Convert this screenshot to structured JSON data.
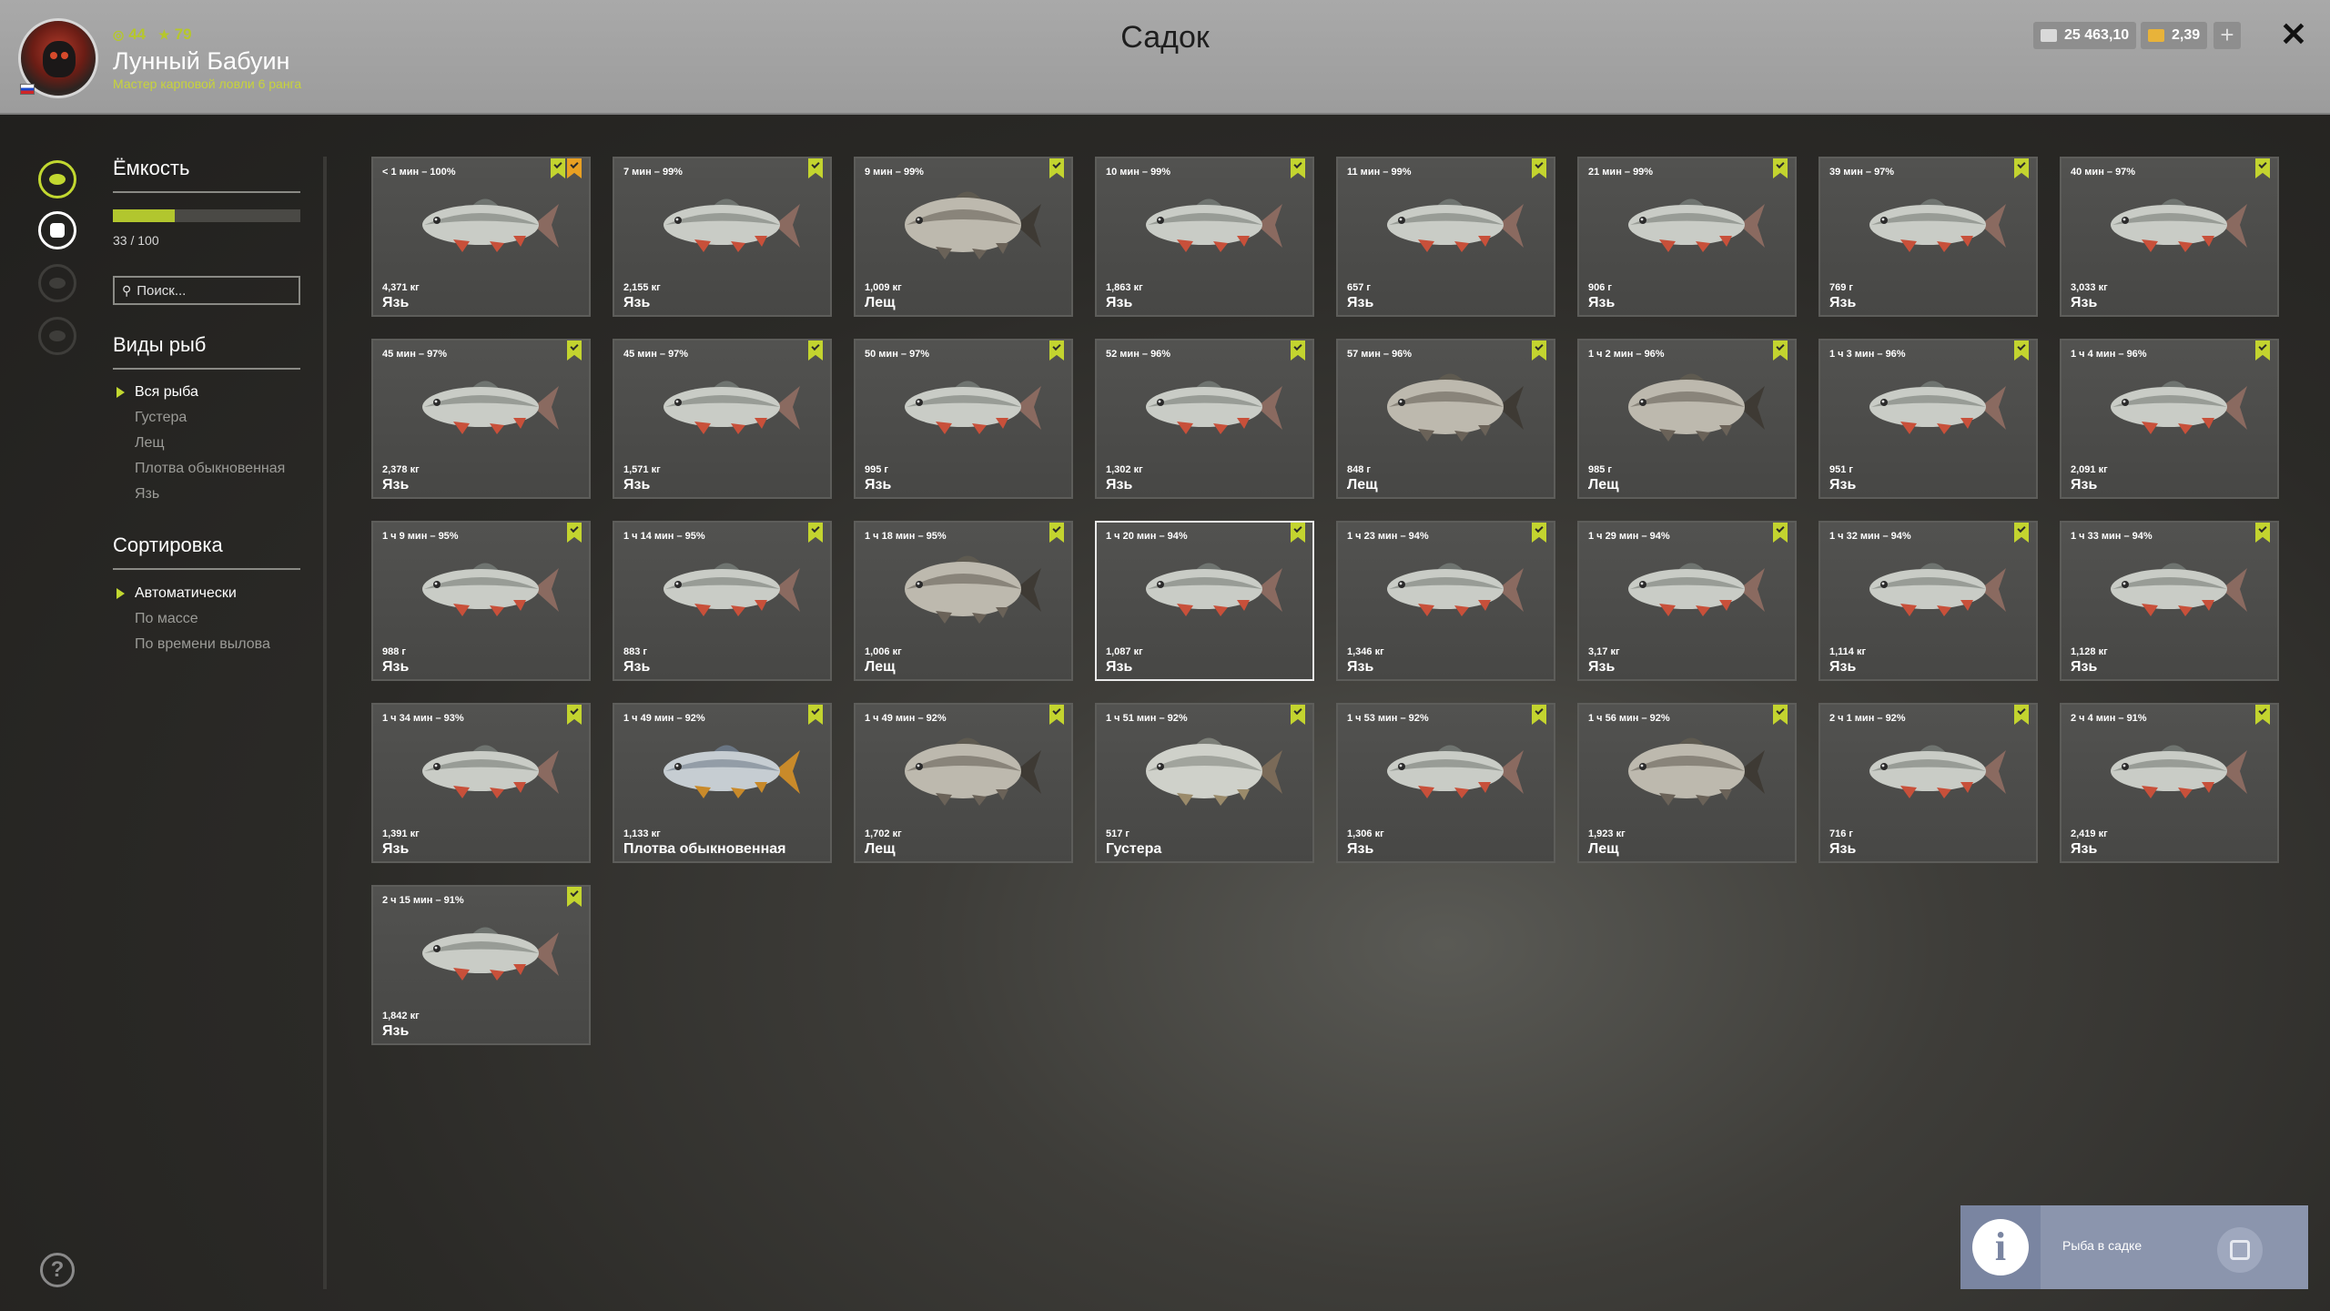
{
  "header": {
    "title": "Садок",
    "player": {
      "name": "Лунный Бабуин",
      "rank_title": "Мастер карповой ловли 6 ранга",
      "level": "44",
      "stars": "79"
    },
    "silver": "25 463,10",
    "gold": "2,39",
    "plus_icon": "+",
    "close_icon": "✕"
  },
  "sidebar": {
    "icons": [
      "fish-icon",
      "keepnet-icon",
      "boat-icon",
      "home-icon"
    ],
    "help_icon": "?"
  },
  "filters": {
    "capacity_title": "Ёмкость",
    "capacity_count": "33 / 100",
    "capacity_fraction": 0.33,
    "search_placeholder": "Поиск...",
    "species_title": "Виды рыб",
    "species": [
      "Вся рыба",
      "Густера",
      "Лещ",
      "Плотва обыкновенная",
      "Язь"
    ],
    "species_selected": 0,
    "sort_title": "Сортировка",
    "sort": [
      "Автоматически",
      "По массе",
      "По времени вылова"
    ],
    "sort_selected": 0
  },
  "fish": [
    {
      "time": "< 1 мин – 100%",
      "weight": "4,371 кг",
      "name": "Язь",
      "trophy": true
    },
    {
      "time": "7 мин – 99%",
      "weight": "2,155 кг",
      "name": "Язь"
    },
    {
      "time": "9 мин – 99%",
      "weight": "1,009 кг",
      "name": "Лещ"
    },
    {
      "time": "10 мин – 99%",
      "weight": "1,863 кг",
      "name": "Язь"
    },
    {
      "time": "11 мин – 99%",
      "weight": "657 г",
      "name": "Язь"
    },
    {
      "time": "21 мин – 99%",
      "weight": "906 г",
      "name": "Язь"
    },
    {
      "time": "39 мин – 97%",
      "weight": "769 г",
      "name": "Язь"
    },
    {
      "time": "40 мин – 97%",
      "weight": "3,033 кг",
      "name": "Язь"
    },
    {
      "time": "45 мин – 97%",
      "weight": "2,378 кг",
      "name": "Язь"
    },
    {
      "time": "45 мин – 97%",
      "weight": "1,571 кг",
      "name": "Язь"
    },
    {
      "time": "50 мин – 97%",
      "weight": "995 г",
      "name": "Язь"
    },
    {
      "time": "52 мин – 96%",
      "weight": "1,302 кг",
      "name": "Язь"
    },
    {
      "time": "57 мин – 96%",
      "weight": "848 г",
      "name": "Лещ"
    },
    {
      "time": "1 ч 2 мин – 96%",
      "weight": "985 г",
      "name": "Лещ"
    },
    {
      "time": "1 ч 3 мин – 96%",
      "weight": "951 г",
      "name": "Язь"
    },
    {
      "time": "1 ч 4 мин – 96%",
      "weight": "2,091 кг",
      "name": "Язь"
    },
    {
      "time": "1 ч 9 мин – 95%",
      "weight": "988 г",
      "name": "Язь"
    },
    {
      "time": "1 ч 14 мин – 95%",
      "weight": "883 г",
      "name": "Язь"
    },
    {
      "time": "1 ч 18 мин – 95%",
      "weight": "1,006 кг",
      "name": "Лещ"
    },
    {
      "time": "1 ч 20 мин – 94%",
      "weight": "1,087 кг",
      "name": "Язь",
      "selected": true
    },
    {
      "time": "1 ч 23 мин – 94%",
      "weight": "1,346 кг",
      "name": "Язь"
    },
    {
      "time": "1 ч 29 мин – 94%",
      "weight": "3,17 кг",
      "name": "Язь"
    },
    {
      "time": "1 ч 32 мин – 94%",
      "weight": "1,114 кг",
      "name": "Язь"
    },
    {
      "time": "1 ч 33 мин – 94%",
      "weight": "1,128 кг",
      "name": "Язь"
    },
    {
      "time": "1 ч 34 мин – 93%",
      "weight": "1,391 кг",
      "name": "Язь"
    },
    {
      "time": "1 ч 49 мин – 92%",
      "weight": "1,133 кг",
      "name": "Плотва обыкновенная"
    },
    {
      "time": "1 ч 49 мин – 92%",
      "weight": "1,702 кг",
      "name": "Лещ"
    },
    {
      "time": "1 ч 51 мин – 92%",
      "weight": "517 г",
      "name": "Густера"
    },
    {
      "time": "1 ч 53 мин – 92%",
      "weight": "1,306 кг",
      "name": "Язь"
    },
    {
      "time": "1 ч 56 мин – 92%",
      "weight": "1,923 кг",
      "name": "Лещ"
    },
    {
      "time": "2 ч 1 мин – 92%",
      "weight": "716 г",
      "name": "Язь"
    },
    {
      "time": "2 ч 4 мин – 91%",
      "weight": "2,419 кг",
      "name": "Язь"
    },
    {
      "time": "2 ч 15 мин – 91%",
      "weight": "1,842 кг",
      "name": "Язь"
    }
  ],
  "notification": {
    "text": "Рыба в садке",
    "icon": "info-icon"
  },
  "colors": {
    "accent": "#c2d830",
    "trophy": "#e8a022",
    "notification": "#8b95ad"
  }
}
